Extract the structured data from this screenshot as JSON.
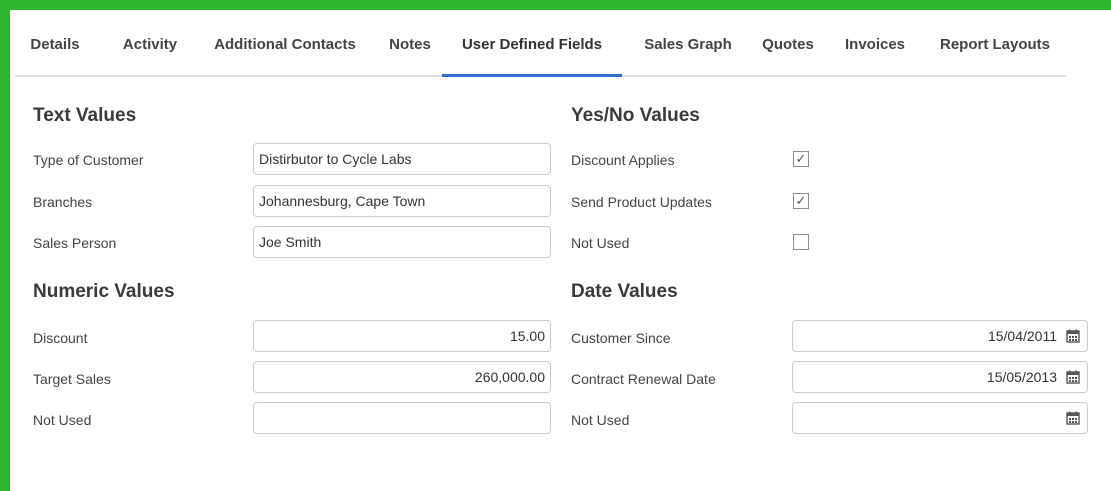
{
  "tabs": [
    {
      "label": "Details"
    },
    {
      "label": "Activity"
    },
    {
      "label": "Additional Contacts"
    },
    {
      "label": "Notes"
    },
    {
      "label": "User Defined Fields"
    },
    {
      "label": "Sales Graph"
    },
    {
      "label": "Quotes"
    },
    {
      "label": "Invoices"
    },
    {
      "label": "Report Layouts"
    }
  ],
  "text_values": {
    "heading": "Text Values",
    "fields": [
      {
        "label": "Type of Customer",
        "value": "Distirbutor to Cycle Labs"
      },
      {
        "label": "Branches",
        "value": "Johannesburg, Cape Town"
      },
      {
        "label": "Sales Person",
        "value": "Joe Smith"
      }
    ]
  },
  "numeric_values": {
    "heading": "Numeric Values",
    "fields": [
      {
        "label": "Discount",
        "value": "15.00"
      },
      {
        "label": "Target Sales",
        "value": "260,000.00"
      },
      {
        "label": "Not Used",
        "value": ""
      }
    ]
  },
  "yesno_values": {
    "heading": "Yes/No Values",
    "fields": [
      {
        "label": "Discount Applies",
        "checked": "✓"
      },
      {
        "label": "Send Product Updates",
        "checked": "✓"
      },
      {
        "label": "Not Used",
        "checked": ""
      }
    ]
  },
  "date_values": {
    "heading": "Date Values",
    "fields": [
      {
        "label": "Customer Since",
        "value": "15/04/2011"
      },
      {
        "label": "Contract Renewal Date",
        "value": "15/05/2013"
      },
      {
        "label": "Not Used",
        "value": ""
      }
    ]
  },
  "colors": {
    "frame": "#2db62d",
    "active_tab_underline": "#2f6fd0"
  },
  "icons": {
    "date_picker": "calendar-icon",
    "check": "check-icon"
  }
}
